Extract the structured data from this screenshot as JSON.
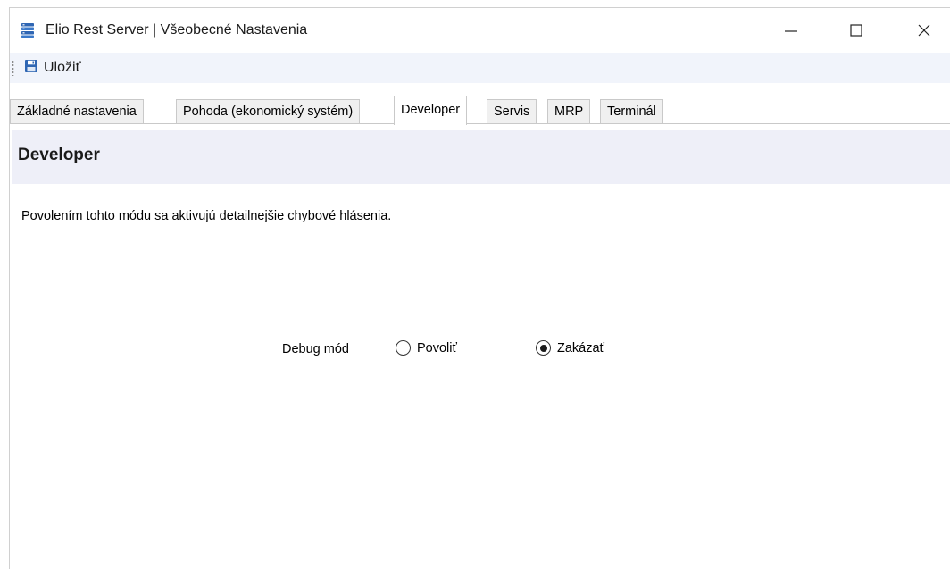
{
  "window": {
    "title": "Elio Rest Server | Všeobecné Nastavenia",
    "app_icon": "database-server-icon"
  },
  "toolbar": {
    "save_label": "Uložiť",
    "save_icon": "floppy-disk-icon"
  },
  "tabs": [
    {
      "label": "Základné nastavenia",
      "active": false
    },
    {
      "label": "Pohoda (ekonomický systém)",
      "active": false
    },
    {
      "label": "Developer",
      "active": true
    },
    {
      "label": "Servis",
      "active": false
    },
    {
      "label": "MRP",
      "active": false
    },
    {
      "label": "Terminál",
      "active": false
    }
  ],
  "panel": {
    "title": "Developer",
    "description": "Povolením tohto módu sa aktivujú detailnejšie chybové hlásenia.",
    "debug_label": "Debug mód",
    "options": [
      {
        "label": "Povoliť",
        "checked": false
      },
      {
        "label": "Zakázať",
        "checked": true
      }
    ]
  },
  "colors": {
    "toolbar_bg": "#f1f4fb",
    "panel_header_bg": "#eeeff8",
    "icon_blue": "#2f66b3"
  }
}
